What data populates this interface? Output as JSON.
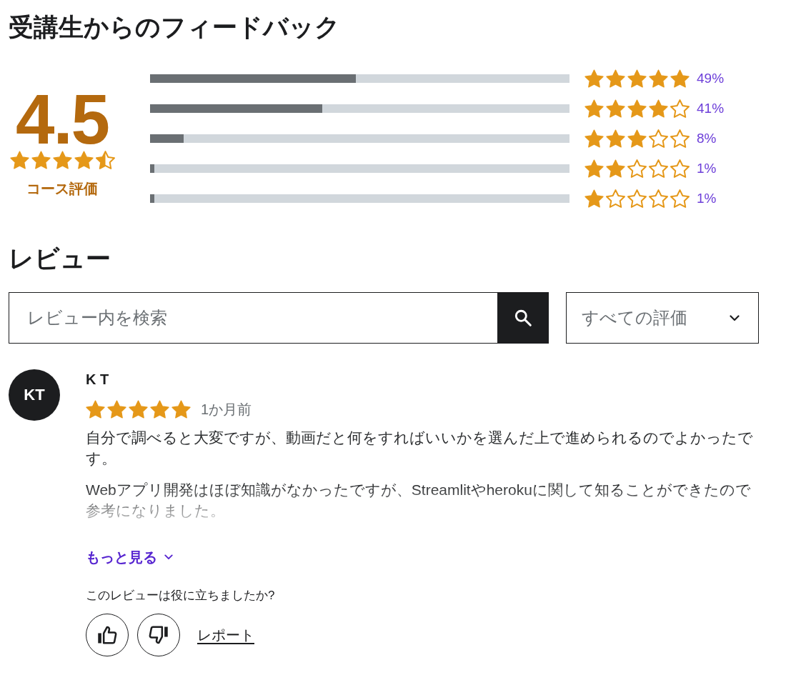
{
  "feedback": {
    "title": "受講生からのフィードバック",
    "rating": "4.5",
    "stars": 4.5,
    "rating_label": "コース評価",
    "breakdown": [
      {
        "level": 0.49,
        "stars": 5,
        "percent": "49%"
      },
      {
        "level": 0.41,
        "stars": 4,
        "percent": "41%"
      },
      {
        "level": 0.08,
        "stars": 3,
        "percent": "8%"
      },
      {
        "level": 0.01,
        "stars": 2,
        "percent": "1%"
      },
      {
        "level": 0.01,
        "stars": 1,
        "percent": "1%"
      }
    ]
  },
  "reviews_section": {
    "title": "レビュー",
    "search": {
      "placeholder": "レビュー内を検索"
    },
    "filter": {
      "value": "すべての評価"
    }
  },
  "reviews": [
    {
      "initials": "KT",
      "name": "K T",
      "stars": 5,
      "time": "1か月前",
      "paragraphs": [
        "自分で調べると大変ですが、動画だと何をすればいいかを選んだ上で進められるのでよかったです。",
        "Webアプリ開発はほぼ知識がなかったですが、Streamlitやherokuに関して知ることができたので参考になりました。"
      ],
      "more": "もっと見る",
      "helpful_prompt": "このレビューは役に立ちましたか?",
      "report": "レポート"
    }
  ]
}
